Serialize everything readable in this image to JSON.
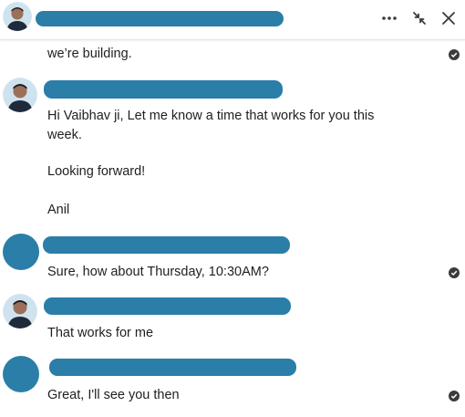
{
  "colors": {
    "redaction": "#2a7ea8",
    "avatar_circle": "#2a7ea8",
    "text": "#1f1f1f",
    "check": "#3b3b3b",
    "divider": "#e4e4e4"
  },
  "header": {
    "more_icon": "more-horizontal-icon",
    "minimize_icon": "minimize-arrows-icon",
    "close_icon": "close-icon"
  },
  "conversation": {
    "partial_message": {
      "text": "we’re building."
    },
    "message_2": {
      "line1": "Hi Vaibhav ji, Let me know a time that works for you this",
      "line2": "week.",
      "line3": "Looking forward!",
      "line4": "Anil"
    },
    "message_3": {
      "text": "Sure, how about Thursday, 10:30AM?"
    },
    "message_4": {
      "text": "That works for me"
    },
    "message_5": {
      "text": "Great, I'll see you then"
    }
  }
}
